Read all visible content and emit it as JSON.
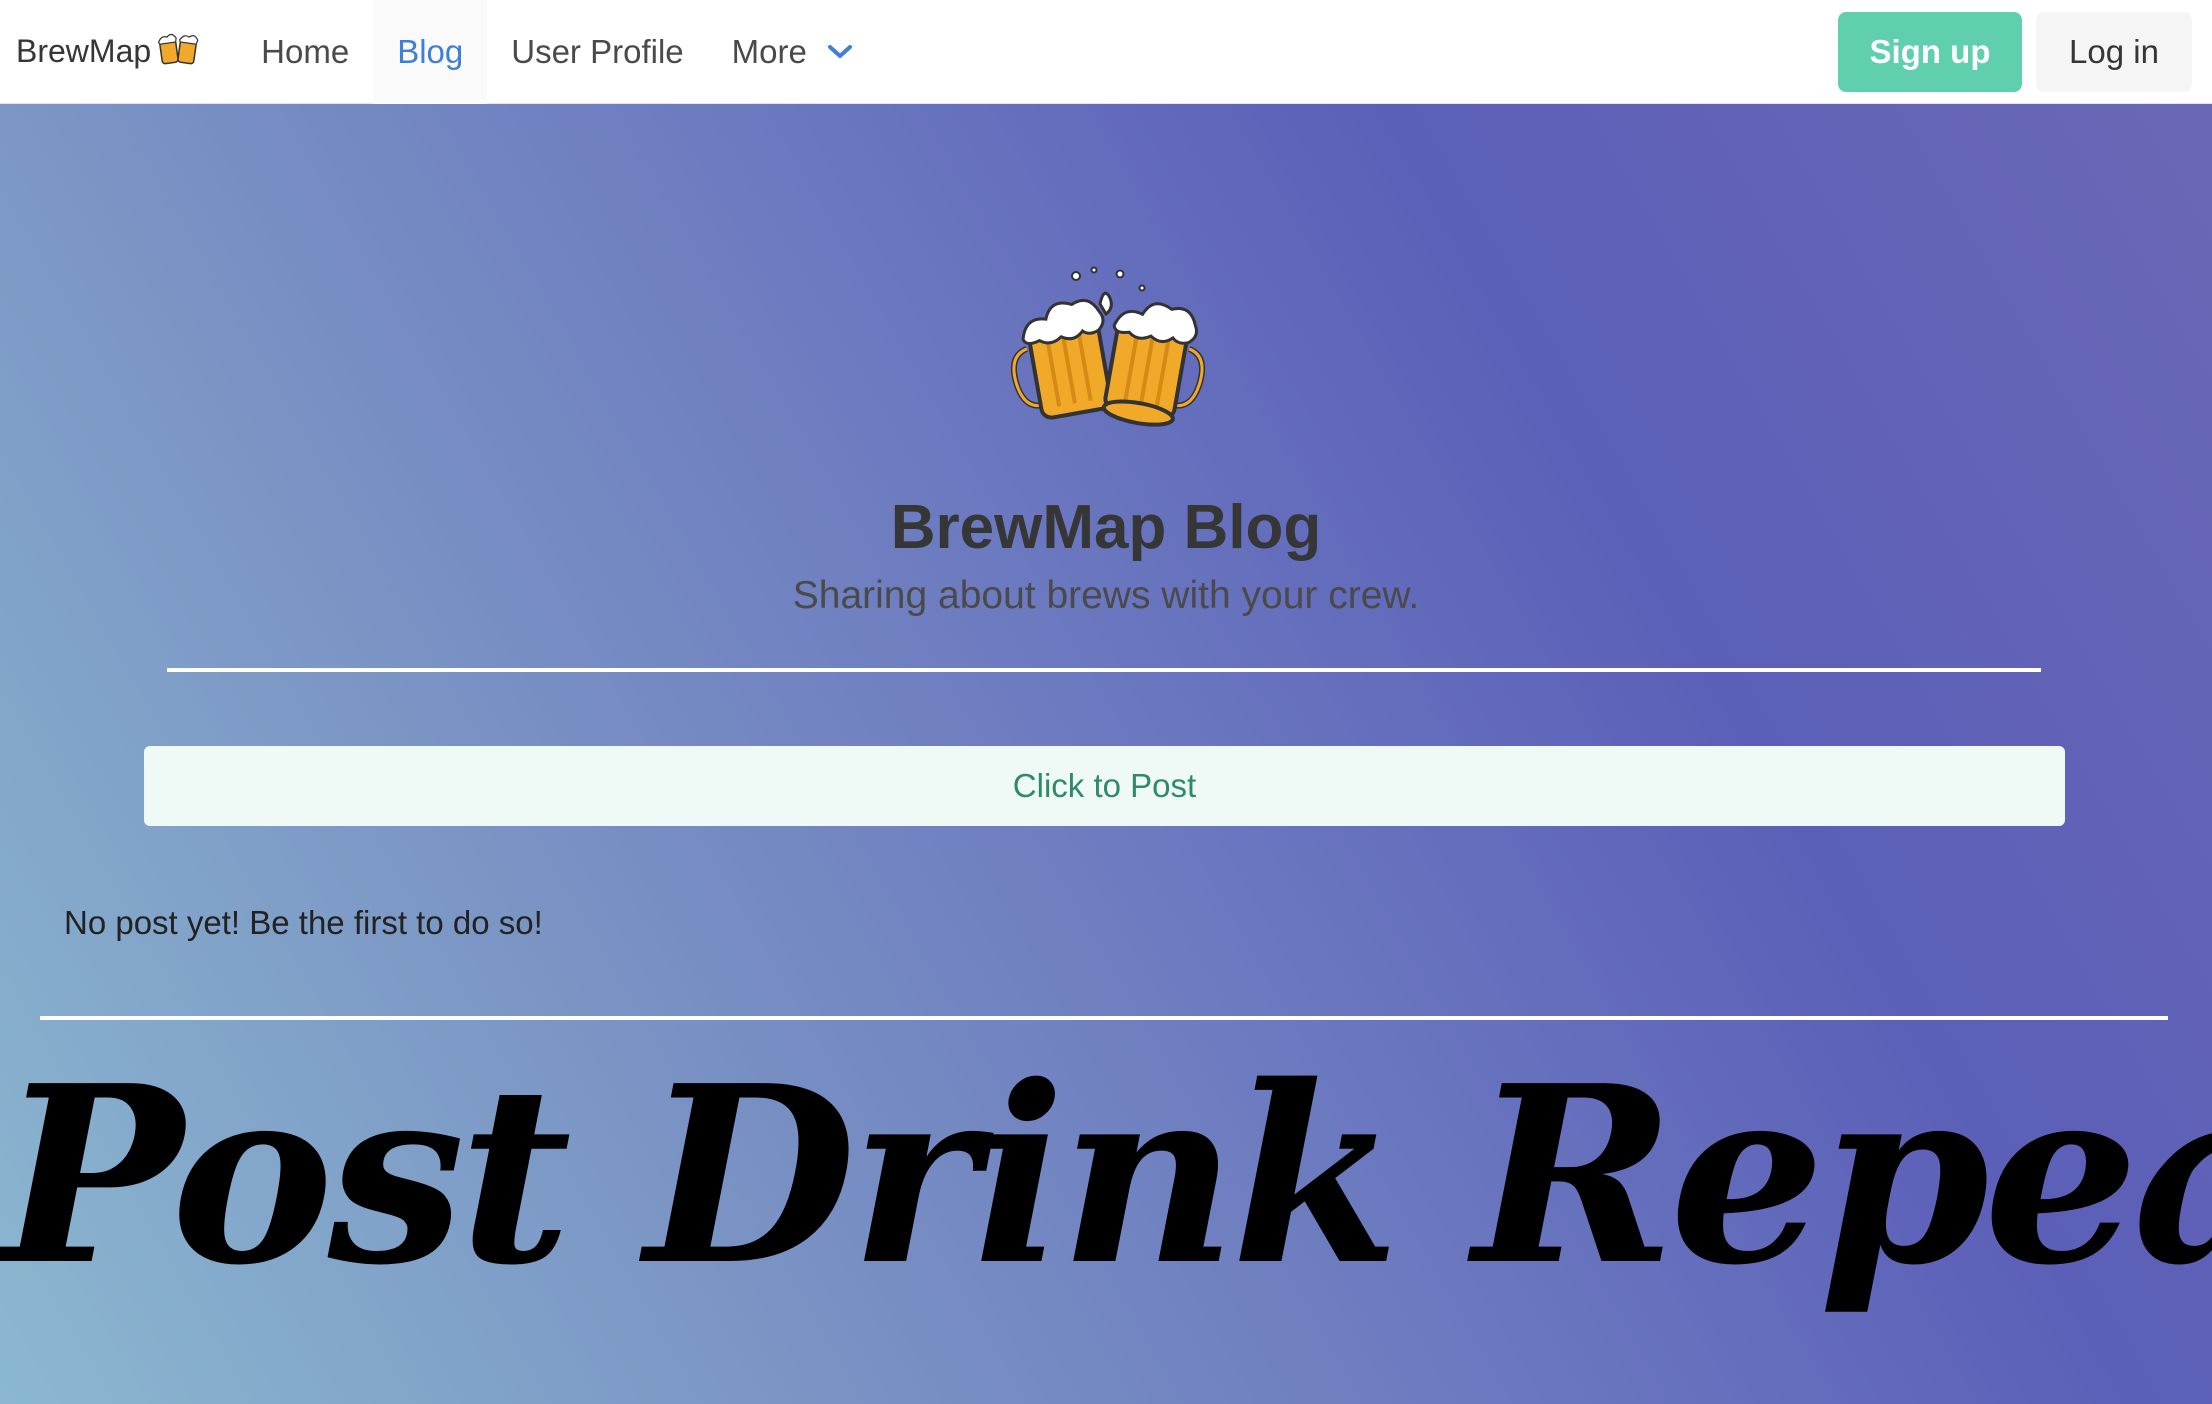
{
  "navbar": {
    "brand": "BrewMap",
    "brand_icon": "beer-mugs-icon",
    "items": [
      {
        "label": "Home",
        "active": false
      },
      {
        "label": "Blog",
        "active": true
      },
      {
        "label": "User Profile",
        "active": false
      }
    ],
    "more_label": "More",
    "more_icon": "chevron-down-icon",
    "signup_label": "Sign up",
    "login_label": "Log in"
  },
  "hero": {
    "logo_icon": "beer-mugs-icon",
    "title": "BrewMap Blog",
    "subtitle": "Sharing about brews with your crew.",
    "post_button_label": "Click to Post",
    "empty_message": "No post yet! Be the first to do so!",
    "slogan": "Post Drink Repeat"
  },
  "colors": {
    "accent_link": "#3e7fd9",
    "signup_bg": "#5fcfad",
    "post_button_text": "#2f8a6a",
    "post_button_bg": "#effaf7",
    "gradient_start": "#8bb8d0",
    "gradient_mid": "#6c7ac0",
    "gradient_end": "#5c5fb8"
  }
}
